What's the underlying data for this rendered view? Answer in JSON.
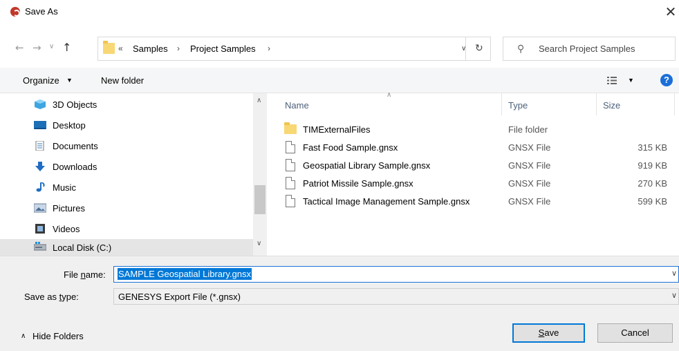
{
  "window": {
    "title": "Save As",
    "close_icon": "close-icon"
  },
  "nav": {
    "chevrons": "«",
    "breadcrumbs": [
      "Samples",
      "Project Samples"
    ],
    "separator": "›",
    "search_placeholder": "Search Project Samples"
  },
  "toolbar": {
    "organize_label": "Organize",
    "new_folder_label": "New folder",
    "help_label": "?"
  },
  "sidebar": {
    "items": [
      {
        "label": "3D Objects",
        "icon": "cube-icon",
        "selected": false
      },
      {
        "label": "Desktop",
        "icon": "desktop-icon",
        "selected": false
      },
      {
        "label": "Documents",
        "icon": "documents-icon",
        "selected": false
      },
      {
        "label": "Downloads",
        "icon": "download-arrow-icon",
        "selected": false
      },
      {
        "label": "Music",
        "icon": "music-note-icon",
        "selected": false
      },
      {
        "label": "Pictures",
        "icon": "pictures-icon",
        "selected": false
      },
      {
        "label": "Videos",
        "icon": "videos-icon",
        "selected": false
      },
      {
        "label": "Local Disk (C:)",
        "icon": "drive-icon",
        "selected": true
      }
    ]
  },
  "file_list": {
    "columns": {
      "name": "Name",
      "type": "Type",
      "size": "Size"
    },
    "rows": [
      {
        "name": "TIMExternalFiles",
        "type": "File folder",
        "size": "",
        "icon": "folder-icon"
      },
      {
        "name": "Fast Food Sample.gnsx",
        "type": "GNSX File",
        "size": "315 KB",
        "icon": "file-icon"
      },
      {
        "name": "Geospatial Library Sample.gnsx",
        "type": "GNSX File",
        "size": "919 KB",
        "icon": "file-icon"
      },
      {
        "name": "Patriot Missile Sample.gnsx",
        "type": "GNSX File",
        "size": "270 KB",
        "icon": "file-icon"
      },
      {
        "name": "Tactical Image Management Sample.gnsx",
        "type": "GNSX File",
        "size": "599 KB",
        "icon": "file-icon"
      }
    ]
  },
  "form": {
    "file_name_label": "File name:",
    "file_name_value": "SAMPLE Geospatial Library.gnsx",
    "save_type_label": "Save as type:",
    "save_type_value": "GENESYS Export File (*.gnsx)"
  },
  "footer": {
    "hide_folders_label": "Hide Folders",
    "save_label": "Save",
    "cancel_label": "Cancel"
  },
  "colors": {
    "accent": "#0078d7",
    "selection": "#e5e5e5",
    "folder": "#f8d775",
    "app_icon": "#c0392b"
  }
}
